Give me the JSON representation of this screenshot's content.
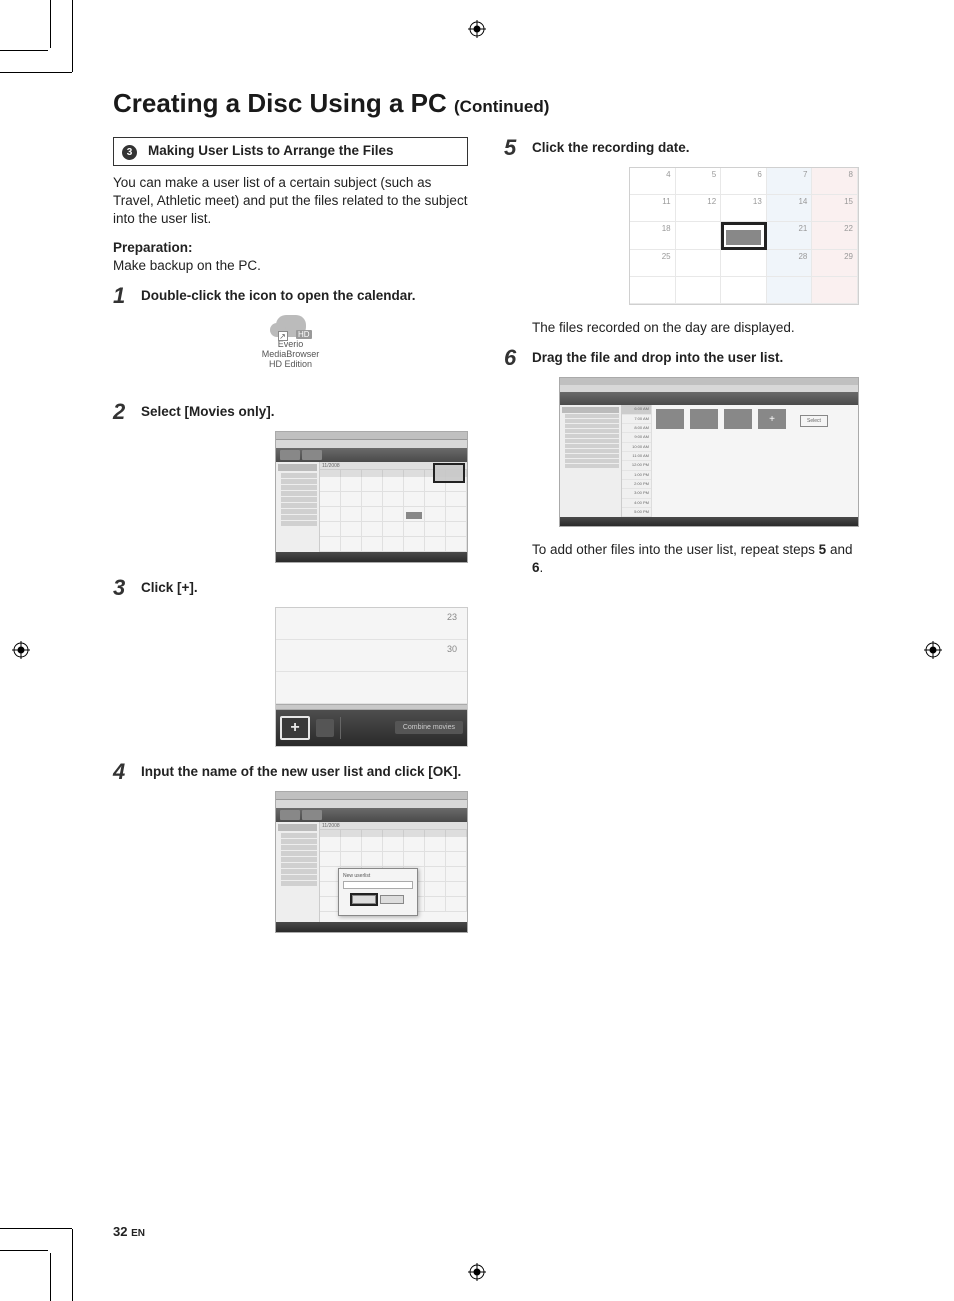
{
  "page": {
    "number": "32",
    "lang": "EN"
  },
  "title": {
    "main": "Creating a Disc Using a PC",
    "cont": "(Continued)"
  },
  "section": {
    "bullet": "3",
    "heading": "Making User Lists to Arrange the Files"
  },
  "intro": "You can make a user list of a certain subject (such as Travel, Athletic meet) and put the files related to the subject into the user list.",
  "prep": {
    "label": "Preparation:",
    "text": "Make backup on the PC."
  },
  "steps": {
    "s1": {
      "num": "1",
      "text": "Double-click the icon to open the calendar."
    },
    "s2": {
      "num": "2",
      "text": "Select [Movies only]."
    },
    "s3": {
      "num": "3",
      "text": "Click [+]."
    },
    "s4": {
      "num": "4",
      "text": "Input the name of the new user list and click [OK]."
    },
    "s5": {
      "num": "5",
      "text": "Click the recording date."
    },
    "s6": {
      "num": "6",
      "text": "Drag the file and drop into the user list."
    }
  },
  "notes": {
    "after5": "The files recorded on the day are displayed.",
    "after6_a": "To add other files into the user list, repeat steps ",
    "after6_b": "5",
    "after6_c": " and ",
    "after6_d": "6",
    "after6_e": "."
  },
  "fig_icon": {
    "line1": "Everio",
    "line2": "MediaBrowser",
    "line3": "HD Edition",
    "arrow": "↗",
    "hd": "HD"
  },
  "fig_app": {
    "month": "11/2008"
  },
  "fig_plus": {
    "r1": "23",
    "r2": "30",
    "plus": "+",
    "combine": "Combine movies"
  },
  "fig_dialog": {
    "label": "New userlist"
  },
  "fig_month": {
    "cells": [
      "4",
      "5",
      "6",
      "7",
      "8",
      "11",
      "12",
      "13",
      "14",
      "15",
      "18",
      "",
      "",
      "21",
      "22",
      "25",
      "",
      "",
      "28",
      "29",
      "",
      "",
      "",
      "",
      ""
    ]
  },
  "fig_list": {
    "times": [
      "6:00 AM",
      "7:00 AM",
      "8:00 AM",
      "9:00 AM",
      "10:00 AM",
      "11:00 AM",
      "12:00 PM",
      "1:00 PM",
      "2:00 PM",
      "3:00 PM",
      "4:00 PM",
      "5:00 PM"
    ],
    "label": "Select",
    "plus": "+"
  }
}
